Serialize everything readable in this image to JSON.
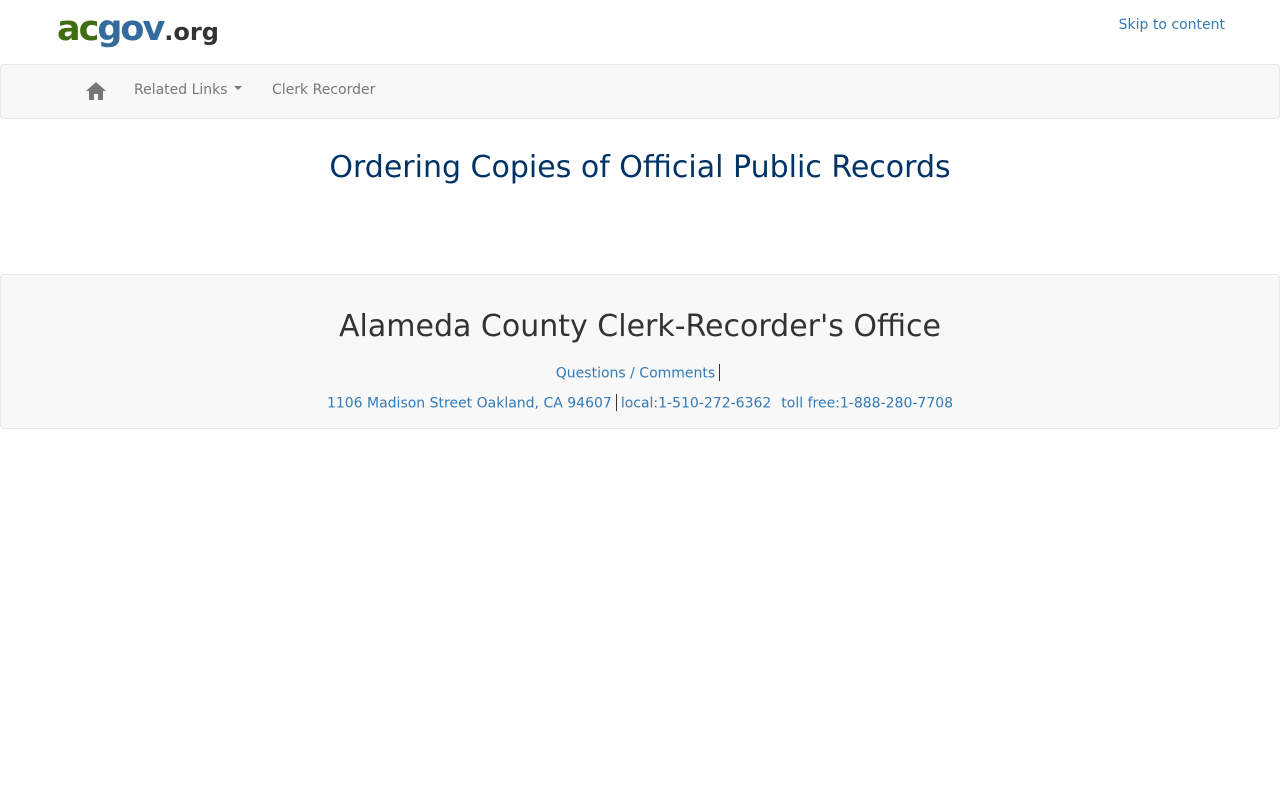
{
  "header": {
    "logo": {
      "ac": "ac",
      "gov": "gov",
      "org": ".org"
    },
    "skip_link": "Skip to content"
  },
  "navbar": {
    "home_icon": "home-icon",
    "items": [
      {
        "label": "Related Links",
        "has_dropdown": true
      },
      {
        "label": "Clerk Recorder",
        "has_dropdown": false
      }
    ]
  },
  "page": {
    "title": "Ordering Copies of Official Public Records"
  },
  "footer": {
    "office_name": "Alameda County Clerk-Recorder's Office",
    "questions_link": "Questions / Comments",
    "address": "1106 Madison Street Oakland, CA 94607",
    "local_phone": "local:1-510-272-6362",
    "toll_free_phone": "toll free:1-888-280-7708"
  },
  "colors": {
    "logo_ac": "#3f6e12",
    "logo_gov": "#336b9c",
    "link": "#337ab7",
    "title": "#003366",
    "navbar_bg": "#f8f8f8"
  }
}
